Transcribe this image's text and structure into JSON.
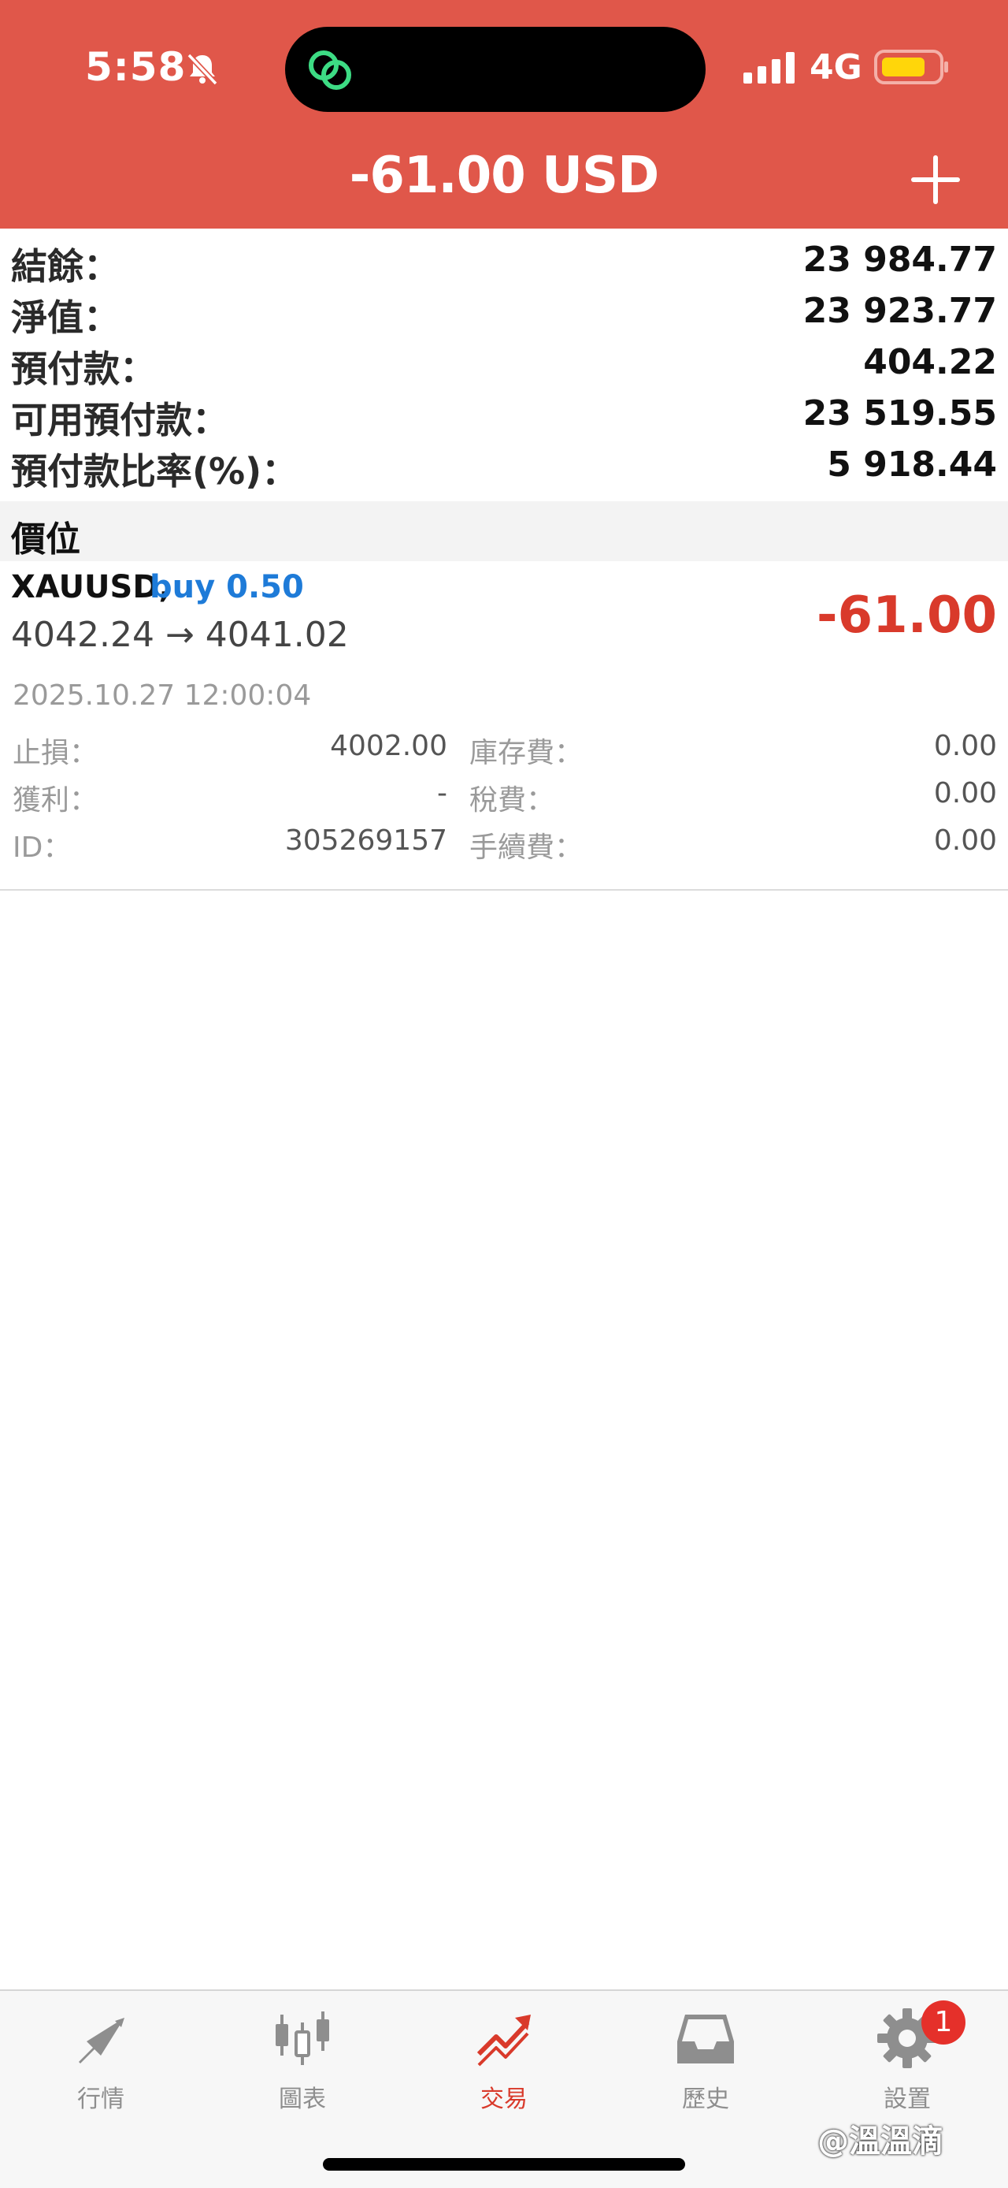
{
  "status_bar": {
    "time": "5:58",
    "network": "4G"
  },
  "header": {
    "title": "-61.00 USD"
  },
  "summary": [
    {
      "label": "結餘：",
      "value": "23 984.77"
    },
    {
      "label": "淨值：",
      "value": "23 923.77"
    },
    {
      "label": "預付款：",
      "value": "404.22"
    },
    {
      "label": "可用預付款：",
      "value": "23 519.55"
    },
    {
      "label": "預付款比率(%)：",
      "value": "5 918.44"
    }
  ],
  "positions_section": {
    "title": "價位"
  },
  "position": {
    "symbol": "XAUUSD,",
    "side": "buy 0.50",
    "prices": "4042.24 → 4041.02",
    "profit": "-61.00",
    "time": "2025.10.27 12:00:04",
    "details": {
      "stop_loss_label": "止損：",
      "stop_loss_value": "4002.00",
      "take_profit_label": "獲利：",
      "take_profit_value": "-",
      "id_label": "ID：",
      "id_value": "305269157",
      "swap_label": "庫存費：",
      "swap_value": "0.00",
      "tax_label": "稅費：",
      "tax_value": "0.00",
      "commission_label": "手續費：",
      "commission_value": "0.00"
    }
  },
  "tabs": [
    {
      "label": "行情",
      "icon": "quotes-icon",
      "active": false
    },
    {
      "label": "圖表",
      "icon": "chart-icon",
      "active": false
    },
    {
      "label": "交易",
      "icon": "trade-icon",
      "active": true
    },
    {
      "label": "歷史",
      "icon": "history-icon",
      "active": false
    },
    {
      "label": "設置",
      "icon": "settings-icon",
      "active": false,
      "badge": "1"
    }
  ],
  "watermark": "@溫溫滴",
  "colors": {
    "header_bg": "#E0574A",
    "loss_red": "#D93A2B",
    "buy_blue": "#1E7BD8",
    "badge_red": "#E5302A"
  }
}
